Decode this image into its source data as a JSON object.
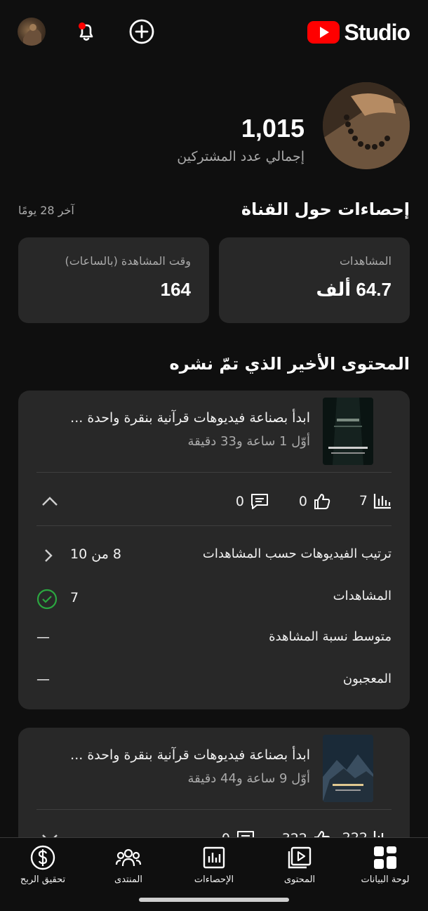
{
  "header": {
    "logo_text": "Studio",
    "icons": [
      "avatar",
      "notifications-icon",
      "create-icon",
      "youtube-logo"
    ]
  },
  "channel": {
    "subscriber_count": "1,015",
    "subscriber_label": "إجمالي عدد المشتركين"
  },
  "analytics": {
    "title": "إحصاءات حول القناة",
    "period": "آخر 28 يومًا",
    "cards": [
      {
        "label": "المشاهدات",
        "value": "64.7 ألف"
      },
      {
        "label": "وقت المشاهدة (بالساعات)",
        "value": "164"
      }
    ]
  },
  "recent": {
    "title": "المحتوى الأخير الذي تمّ نشره",
    "videos": [
      {
        "title": "ابدأ بصناعة فيديوهات قرآنية بنقرة واحدة ...",
        "subtitle": "أوّل 1 ساعة و33 دقيقة",
        "views": "7",
        "likes": "0",
        "comments": "0",
        "rows": [
          {
            "label": "ترتيب الفيديوهات حسب المشاهدات",
            "value": "8 من 10"
          },
          {
            "label": "المشاهدات",
            "value": "7"
          },
          {
            "label": "متوسط نسبة المشاهدة",
            "value": "—"
          },
          {
            "label": "المعجبون",
            "value": "—"
          }
        ]
      },
      {
        "title": "ابدأ بصناعة فيديوهات قرآنية بنقرة واحدة ...",
        "subtitle": "أوّل 9 ساعة و44 دقيقة",
        "views": "222",
        "likes": "322",
        "comments": "0"
      }
    ]
  },
  "nav": {
    "items": [
      {
        "label": "لوحة البيانات",
        "icon": "dashboard-icon"
      },
      {
        "label": "المحتوى",
        "icon": "content-icon"
      },
      {
        "label": "الإحصاءات",
        "icon": "analytics-icon"
      },
      {
        "label": "المنتدى",
        "icon": "community-icon"
      },
      {
        "label": "تحقيق الربح",
        "icon": "earn-icon"
      }
    ]
  },
  "colors": {
    "background": "#0f0f0f",
    "card": "#282828",
    "accent_red": "#ff0000",
    "check_green": "#2ba640"
  }
}
